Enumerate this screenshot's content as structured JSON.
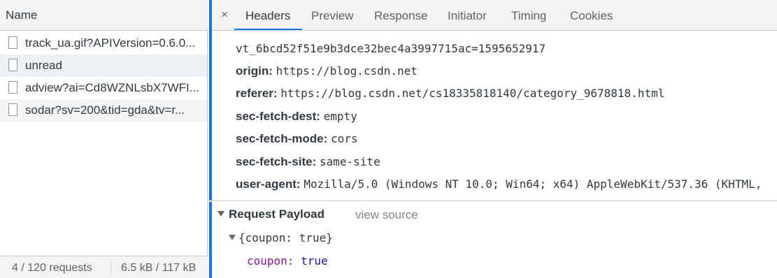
{
  "request_list": {
    "column_header": "Name",
    "rows": [
      {
        "name": "track_ua.gif?APIVersion=0.6.0..."
      },
      {
        "name": "unread"
      },
      {
        "name": "adview?ai=Cd8WZNLsbX7WFI..."
      },
      {
        "name": "sodar?sv=200&tid=gda&tv=r..."
      }
    ],
    "footer": {
      "requests": "4 / 120 requests",
      "size": "6.5 kB / 117 kB"
    }
  },
  "details": {
    "close_icon": "×",
    "tabs": [
      {
        "label": "Headers",
        "active": true
      },
      {
        "label": "Preview",
        "active": false
      },
      {
        "label": "Response",
        "active": false
      },
      {
        "label": "Initiator",
        "active": false
      },
      {
        "label": "Timing",
        "active": false
      },
      {
        "label": "Cookies",
        "active": false
      }
    ],
    "headers": {
      "cut_line": "vt_6bcd52f51e9b3dce32bec4a3997715ac=1595652917",
      "rows": [
        {
          "key": "origin:",
          "value": "https://blog.csdn.net"
        },
        {
          "key": "referer:",
          "value": "https://blog.csdn.net/cs18335818140/category_9678818.html"
        },
        {
          "key": "sec-fetch-dest:",
          "value": "empty"
        },
        {
          "key": "sec-fetch-mode:",
          "value": "cors"
        },
        {
          "key": "sec-fetch-site:",
          "value": "same-site"
        },
        {
          "key": "user-agent:",
          "value": "Mozilla/5.0 (Windows NT 10.0; Win64; x64) AppleWebKit/537.36 (KHTML,"
        }
      ]
    },
    "payload": {
      "title": "Request Payload",
      "view_source": "view source",
      "object_summary": "{coupon: true}",
      "prop_key": "coupon",
      "prop_colon": ":",
      "prop_value": "true"
    }
  },
  "colors": {
    "accent": "#1a73e8",
    "prop_key": "#881391",
    "prop_value": "#1a1aa6"
  }
}
